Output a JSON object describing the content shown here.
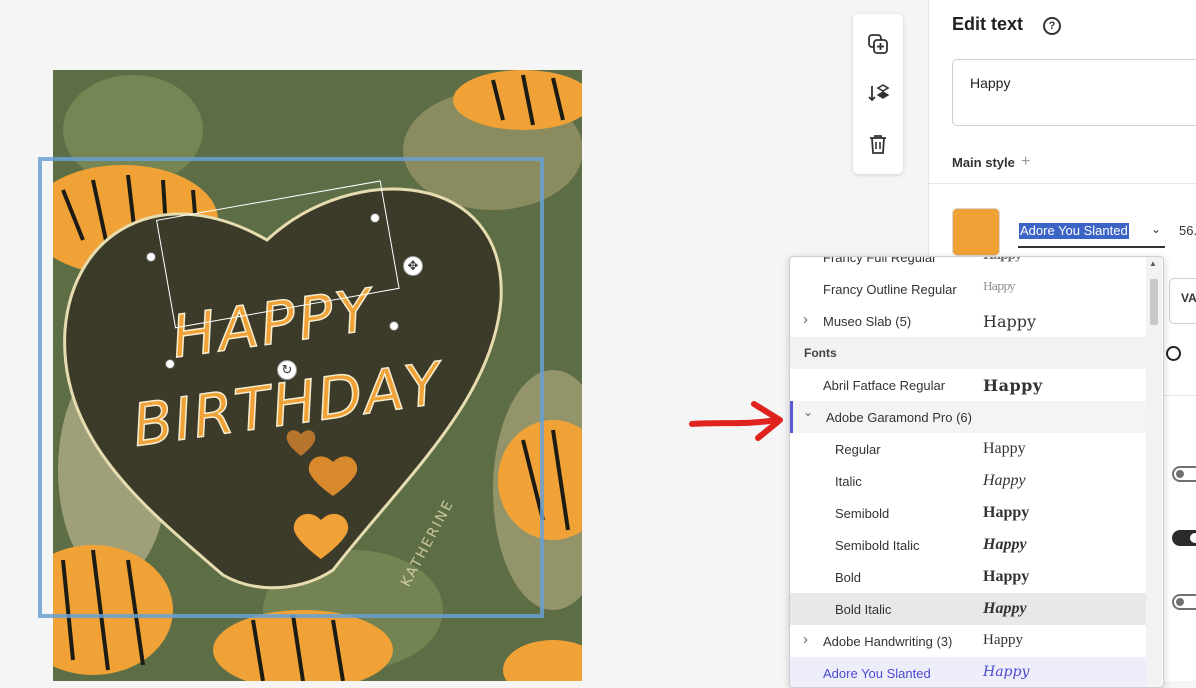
{
  "panel": {
    "title": "Edit text",
    "text_value": "Happy",
    "main_style_label": "Main style",
    "selected_font": "Adore You Slanted",
    "font_size": "56.",
    "va_label": "VA",
    "accent_color": "#f0a236"
  },
  "card": {
    "line1": "HAPPY",
    "line2": "BIRTHDAY",
    "watermark": "KATHERINE"
  },
  "toolbar": {
    "icons": [
      "duplicate-icon",
      "arrange-icon",
      "delete-icon"
    ]
  },
  "font_dropdown": {
    "sample": "Happy",
    "rows": [
      {
        "name": "Francy Full Regular",
        "sample": "Happy",
        "kind": "item"
      },
      {
        "name": "Francy Outline Regular",
        "sample": "Happy",
        "kind": "item"
      },
      {
        "name": "Museo Slab (5)",
        "sample": "Happy",
        "kind": "family-collapsed"
      },
      {
        "name": "Fonts",
        "kind": "header"
      },
      {
        "name": "Abril Fatface Regular",
        "sample": "Happy",
        "kind": "item"
      },
      {
        "name": "Adobe Garamond Pro (6)",
        "kind": "family-expanded"
      },
      {
        "name": "Regular",
        "sample": "Happy",
        "kind": "variant"
      },
      {
        "name": "Italic",
        "sample": "Happy",
        "kind": "variant"
      },
      {
        "name": "Semibold",
        "sample": "Happy",
        "kind": "variant"
      },
      {
        "name": "Semibold Italic",
        "sample": "Happy",
        "kind": "variant"
      },
      {
        "name": "Bold",
        "sample": "Happy",
        "kind": "variant"
      },
      {
        "name": "Bold Italic",
        "sample": "Happy",
        "kind": "variant-hover"
      },
      {
        "name": "Adobe Handwriting (3)",
        "sample": "Happy",
        "kind": "family-collapsed"
      },
      {
        "name": "Adore You Slanted",
        "sample": "Happy",
        "kind": "selected"
      }
    ]
  }
}
